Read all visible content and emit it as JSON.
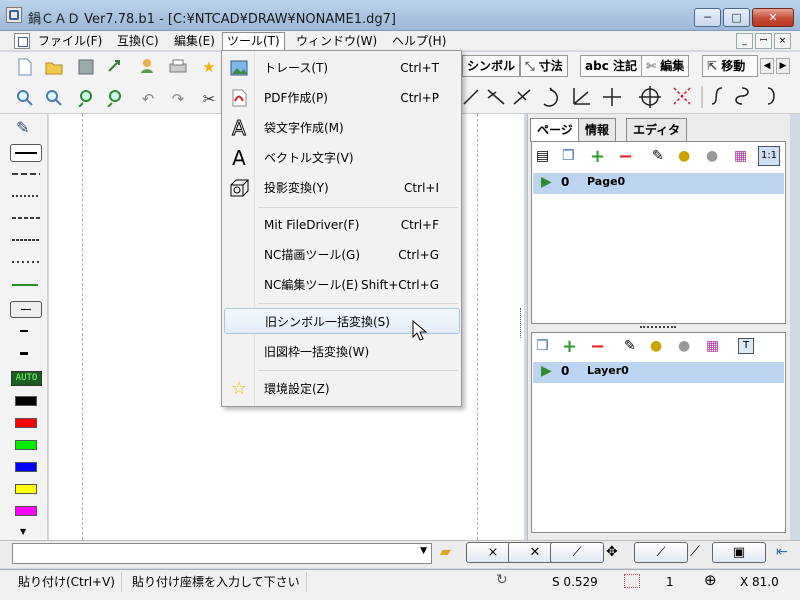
{
  "window": {
    "title": "鍋ＣＡＤ Ver7.78.b1 - [C:¥NTCAD¥DRAW¥NONAME1.dg7]",
    "min_glyph": "─",
    "max_glyph": "□",
    "close_glyph": "✕"
  },
  "menubar": {
    "items": [
      {
        "label": "ファイル(F)"
      },
      {
        "label": "互換(C)"
      },
      {
        "label": "編集(E)"
      },
      {
        "label": "ツール(T)"
      },
      {
        "label": "ウィンドウ(W)"
      },
      {
        "label": "ヘルプ(H)"
      }
    ],
    "mdi": [
      "_",
      "ꟷ",
      "×"
    ]
  },
  "toolbar_tabs": [
    {
      "label": "シンボル"
    },
    {
      "label": "寸法"
    },
    {
      "label": "abc 注記"
    },
    {
      "label": "編集"
    },
    {
      "label": "移動"
    }
  ],
  "tools_menu": {
    "items": [
      {
        "label": "トレース(T)",
        "shortcut": "Ctrl+T",
        "icon": "image-icon"
      },
      {
        "label": "PDF作成(P)",
        "shortcut": "Ctrl+P",
        "icon": "pdf-icon"
      },
      {
        "label": "袋文字作成(M)",
        "shortcut": "",
        "icon": "outline-letter-icon"
      },
      {
        "label": "ベクトル文字(V)",
        "shortcut": "",
        "icon": "vector-letter-icon"
      },
      {
        "label": "投影変換(Y)",
        "shortcut": "Ctrl+I",
        "icon": "projection-cube-icon"
      },
      {
        "label": "Mit FileDriver(F)",
        "shortcut": "Ctrl+F",
        "icon": ""
      },
      {
        "label": "NC描画ツール(G)",
        "shortcut": "Ctrl+G",
        "icon": ""
      },
      {
        "label": "NC編集ツール(E)",
        "shortcut": "Shift+Ctrl+G",
        "icon": ""
      },
      {
        "label": "旧シンボル一括変換(S)",
        "shortcut": "",
        "icon": ""
      },
      {
        "label": "旧図枠一括変換(W)",
        "shortcut": "",
        "icon": ""
      },
      {
        "label": "環境設定(Z)",
        "shortcut": "",
        "icon": "star-icon"
      }
    ]
  },
  "right_panel": {
    "tabs": [
      {
        "label": "ページ"
      },
      {
        "label": "情報"
      },
      {
        "label": "エディタ"
      }
    ],
    "page_row": {
      "index": "0",
      "name": "Page0"
    },
    "layer_row": {
      "index": "0",
      "name": "Layer0"
    }
  },
  "left_tools": {
    "auto_label": "AUTO",
    "colors": [
      "#000000",
      "#ff0000",
      "#00e000",
      "#0000ff",
      "#ffff00",
      "#ff00ff"
    ]
  },
  "statusbar": {
    "paste": "貼り付け(Ctrl+V)",
    "prompt": "貼り付け座標を入力して下さい",
    "scale": "S 0.529",
    "count": "1",
    "x_coord": "X 81.0"
  },
  "colors": {
    "accent": "#3b7bd4",
    "hover_bg": "#e3edf9",
    "selected_row": "#bcd4ef"
  }
}
